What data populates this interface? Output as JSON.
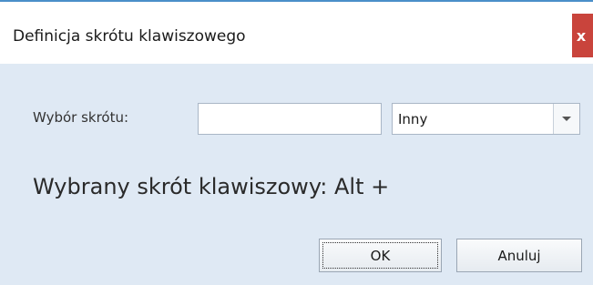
{
  "window": {
    "title": "Definicja skrótu klawiszowego",
    "close_label": "x"
  },
  "form": {
    "shortcut_label": "Wybór skrótu:",
    "shortcut_value": "",
    "key_select_value": "Inny",
    "selected_shortcut_text": "Wybrany skrót klawiszowy: Alt +"
  },
  "buttons": {
    "ok_label": "OK",
    "cancel_label": "Anuluj"
  },
  "colors": {
    "accent_line": "#4a8fc9",
    "dialog_background": "#dfe9f4",
    "close_button": "#c9443c"
  }
}
